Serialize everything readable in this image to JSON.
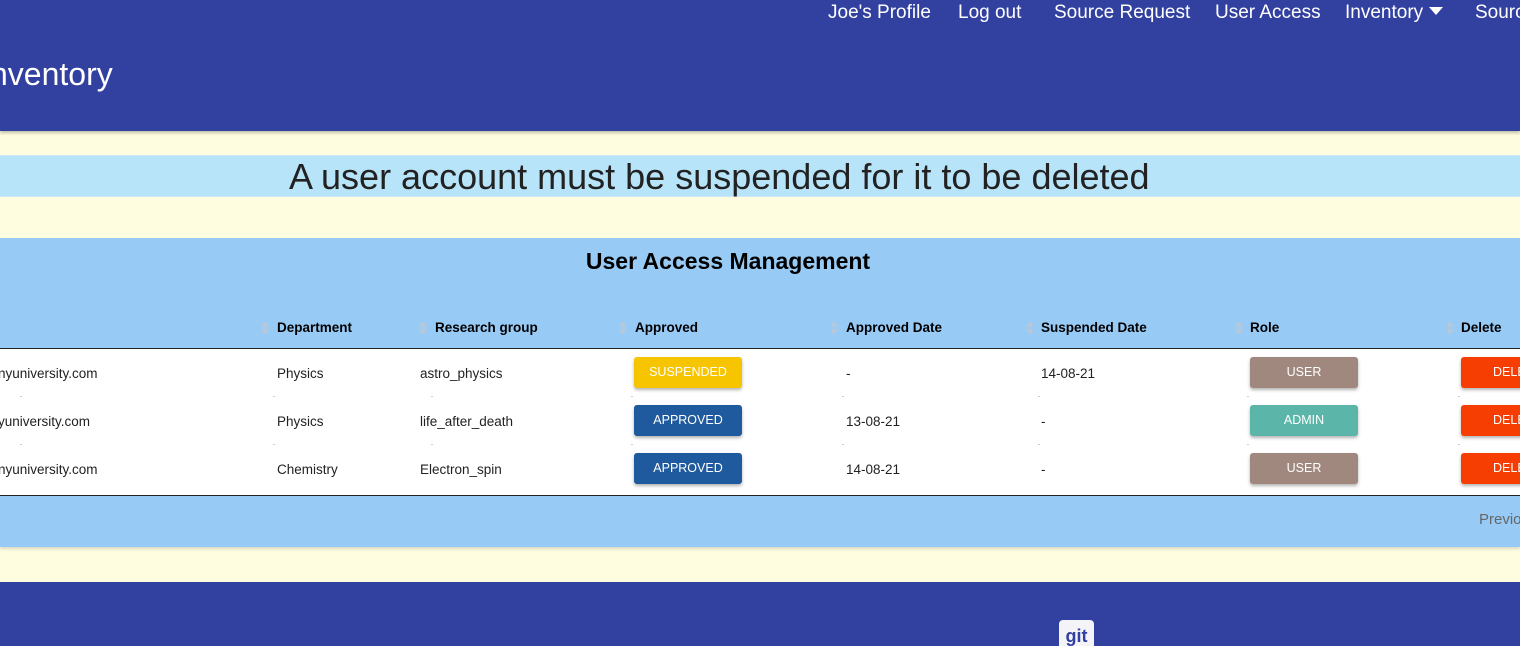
{
  "header": {
    "brand": "nventory",
    "nav": [
      {
        "label": "Joe's Profile"
      },
      {
        "label": "Log out"
      },
      {
        "label": "Source Request"
      },
      {
        "label": "User Access"
      },
      {
        "label": "Inventory"
      },
      {
        "label": "Sourc"
      }
    ]
  },
  "notice": {
    "text": "A user account must be suspended for it to be deleted"
  },
  "table": {
    "title": "User Access Management",
    "columns": [
      "Department",
      "Research group",
      "Approved",
      "Approved Date",
      "Suspended Date",
      "Role",
      "Delete"
    ],
    "rows": [
      {
        "email": "nyuniversity.com",
        "department": "Physics",
        "research_group": "astro_physics",
        "approved": "SUSPENDED",
        "approved_date": "-",
        "suspended_date": "14-08-21",
        "role": "USER",
        "delete": "DELE"
      },
      {
        "email": "yuniversity.com",
        "department": "Physics",
        "research_group": "life_after_death",
        "approved": "APPROVED",
        "approved_date": "13-08-21",
        "suspended_date": "-",
        "role": "ADMIN",
        "delete": "DELE"
      },
      {
        "email": "nyuniversity.com",
        "department": "Chemistry",
        "research_group": "Electron_spin",
        "approved": "APPROVED",
        "approved_date": "14-08-21",
        "suspended_date": "-",
        "role": "USER",
        "delete": "DELE"
      }
    ],
    "pagination": {
      "prev_label": "Previo"
    }
  },
  "footer": {
    "git_label": "git"
  },
  "colors": {
    "header_bg": "#3240a0",
    "page_bg": "#fffde0",
    "notice_bg": "#b8e4fa",
    "panel_bg": "#98caf6",
    "suspended": "#f7c500",
    "approved": "#1f5a9e",
    "user_role": "#a1887f",
    "admin_role": "#5bb5a9",
    "delete": "#f63e02"
  }
}
